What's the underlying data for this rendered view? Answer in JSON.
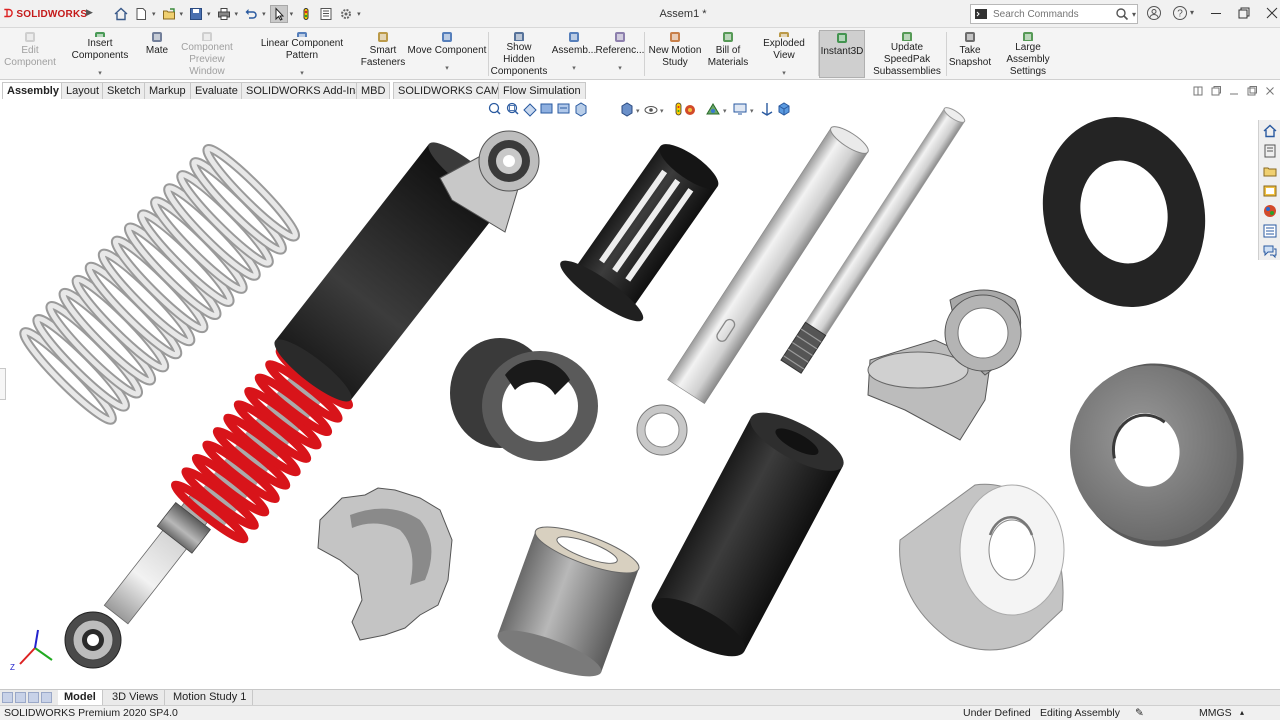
{
  "app": {
    "logo_text": "SOLIDWORKS",
    "document_title": "Assem1 *"
  },
  "quick_access": {
    "icons": [
      "home-icon",
      "new-document-icon",
      "open-icon",
      "save-icon",
      "print-icon",
      "undo-icon",
      "select-icon",
      "rebuild-icon",
      "file-properties-icon",
      "options-icon"
    ]
  },
  "search": {
    "placeholder": "Search Commands"
  },
  "ribbon": {
    "buttons": [
      {
        "id": "edit-component",
        "label1": "Edit",
        "label2": "Component",
        "enabled": false,
        "dropdown": false
      },
      {
        "id": "insert-components",
        "label1": "Insert Components",
        "label2": "",
        "enabled": true,
        "dropdown": true
      },
      {
        "id": "mate",
        "label1": "Mate",
        "label2": "",
        "enabled": true,
        "dropdown": false
      },
      {
        "id": "component-preview",
        "label1": "Component",
        "label2": "Preview Window",
        "enabled": false,
        "dropdown": false
      },
      {
        "id": "linear-pattern",
        "label1": "Linear Component Pattern",
        "label2": "",
        "enabled": true,
        "dropdown": true
      },
      {
        "id": "smart-fasteners",
        "label1": "Smart",
        "label2": "Fasteners",
        "enabled": true,
        "dropdown": false
      },
      {
        "id": "move-component",
        "label1": "Move Component",
        "label2": "",
        "enabled": true,
        "dropdown": true
      },
      {
        "id": "show-hidden",
        "label1": "Show Hidden",
        "label2": "Components",
        "enabled": true,
        "dropdown": false
      },
      {
        "id": "assembly",
        "label1": "Assemb...",
        "label2": "",
        "enabled": true,
        "dropdown": true
      },
      {
        "id": "reference",
        "label1": "Referenc...",
        "label2": "",
        "enabled": true,
        "dropdown": true
      },
      {
        "id": "motion-study",
        "label1": "New Motion",
        "label2": "Study",
        "enabled": true,
        "dropdown": false
      },
      {
        "id": "bom",
        "label1": "Bill of",
        "label2": "Materials",
        "enabled": true,
        "dropdown": false
      },
      {
        "id": "exploded-view",
        "label1": "Exploded View",
        "label2": "",
        "enabled": true,
        "dropdown": true
      },
      {
        "id": "instant3d",
        "label1": "Instant3D",
        "label2": "",
        "enabled": true,
        "dropdown": false,
        "active": true
      },
      {
        "id": "speedpak",
        "label1": "Update SpeedPak",
        "label2": "Subassemblies",
        "enabled": true,
        "dropdown": false
      },
      {
        "id": "snapshot",
        "label1": "Take",
        "label2": "Snapshot",
        "enabled": true,
        "dropdown": false
      },
      {
        "id": "large-assembly",
        "label1": "Large Assembly",
        "label2": "Settings",
        "enabled": true,
        "dropdown": false
      }
    ]
  },
  "tabs": [
    {
      "label": "Assembly",
      "active": true
    },
    {
      "label": "Layout"
    },
    {
      "label": "Sketch"
    },
    {
      "label": "Markup"
    },
    {
      "label": "Evaluate"
    },
    {
      "label": "SOLIDWORKS Add-Ins"
    },
    {
      "label": "MBD"
    },
    {
      "label": "SOLIDWORKS CAM"
    },
    {
      "label": "Flow Simulation"
    }
  ],
  "bottom_tabs": [
    {
      "label": "Model",
      "active": true
    },
    {
      "label": "3D Views"
    },
    {
      "label": "Motion Study 1"
    }
  ],
  "status": {
    "product": "SOLIDWORKS Premium 2020 SP4.0",
    "definition": "Under Defined",
    "mode": "Editing Assembly",
    "units": "MMGS"
  },
  "colors": {
    "spring_red": "#d8141a",
    "rubber_black": "#2a2a2a",
    "metal_light": "#d9d9d9",
    "metal_dark": "#8a8a8a",
    "accent_logo": "#c41a1a"
  }
}
